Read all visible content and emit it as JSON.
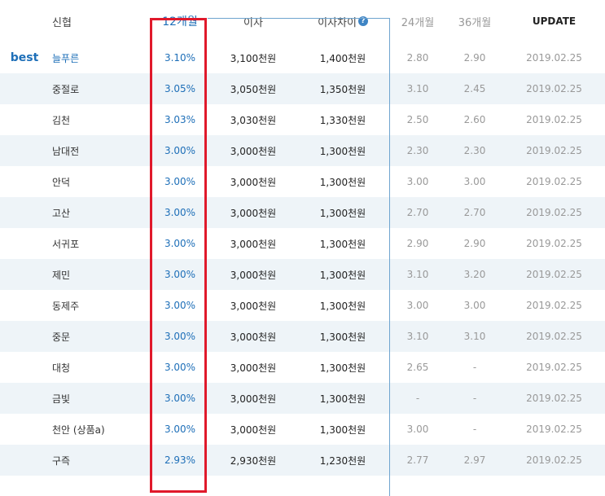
{
  "header": {
    "name": "신협",
    "m12": "12개월",
    "interest": "이자",
    "diff": "이자차이",
    "m24": "24개월",
    "m36": "36개월",
    "update": "UPDATE"
  },
  "best_label": "best",
  "rows": [
    {
      "name": "늘푸른",
      "r12": "3.10%",
      "interest": "3,100천원",
      "diff": "1,400천원",
      "r24": "2.80",
      "r36": "2.90",
      "update": "2019.02.25"
    },
    {
      "name": "중절로",
      "r12": "3.05%",
      "interest": "3,050천원",
      "diff": "1,350천원",
      "r24": "3.10",
      "r36": "2.45",
      "update": "2019.02.25"
    },
    {
      "name": "김천",
      "r12": "3.03%",
      "interest": "3,030천원",
      "diff": "1,330천원",
      "r24": "2.50",
      "r36": "2.60",
      "update": "2019.02.25"
    },
    {
      "name": "남대전",
      "r12": "3.00%",
      "interest": "3,000천원",
      "diff": "1,300천원",
      "r24": "2.30",
      "r36": "2.30",
      "update": "2019.02.25"
    },
    {
      "name": "안덕",
      "r12": "3.00%",
      "interest": "3,000천원",
      "diff": "1,300천원",
      "r24": "3.00",
      "r36": "3.00",
      "update": "2019.02.25"
    },
    {
      "name": "고산",
      "r12": "3.00%",
      "interest": "3,000천원",
      "diff": "1,300천원",
      "r24": "2.70",
      "r36": "2.70",
      "update": "2019.02.25"
    },
    {
      "name": "서귀포",
      "r12": "3.00%",
      "interest": "3,000천원",
      "diff": "1,300천원",
      "r24": "2.90",
      "r36": "2.90",
      "update": "2019.02.25"
    },
    {
      "name": "제민",
      "r12": "3.00%",
      "interest": "3,000천원",
      "diff": "1,300천원",
      "r24": "3.10",
      "r36": "3.20",
      "update": "2019.02.25"
    },
    {
      "name": "동제주",
      "r12": "3.00%",
      "interest": "3,000천원",
      "diff": "1,300천원",
      "r24": "3.00",
      "r36": "3.00",
      "update": "2019.02.25"
    },
    {
      "name": "중문",
      "r12": "3.00%",
      "interest": "3,000천원",
      "diff": "1,300천원",
      "r24": "3.10",
      "r36": "3.10",
      "update": "2019.02.25"
    },
    {
      "name": "대청",
      "r12": "3.00%",
      "interest": "3,000천원",
      "diff": "1,300천원",
      "r24": "2.65",
      "r36": "-",
      "update": "2019.02.25"
    },
    {
      "name": "금빛",
      "r12": "3.00%",
      "interest": "3,000천원",
      "diff": "1,300천원",
      "r24": "-",
      "r36": "-",
      "update": "2019.02.25"
    },
    {
      "name": "천안 (상품a)",
      "r12": "3.00%",
      "interest": "3,000천원",
      "diff": "1,300천원",
      "r24": "3.00",
      "r36": "-",
      "update": "2019.02.25"
    },
    {
      "name": "구즉",
      "r12": "2.93%",
      "interest": "2,930천원",
      "diff": "1,230천원",
      "r24": "2.77",
      "r36": "2.97",
      "update": "2019.02.25"
    }
  ],
  "colors": {
    "accent": "#1e6fb8",
    "highlight_border": "#e0192b",
    "alt_row": "#eef4f8",
    "muted": "#999999"
  }
}
